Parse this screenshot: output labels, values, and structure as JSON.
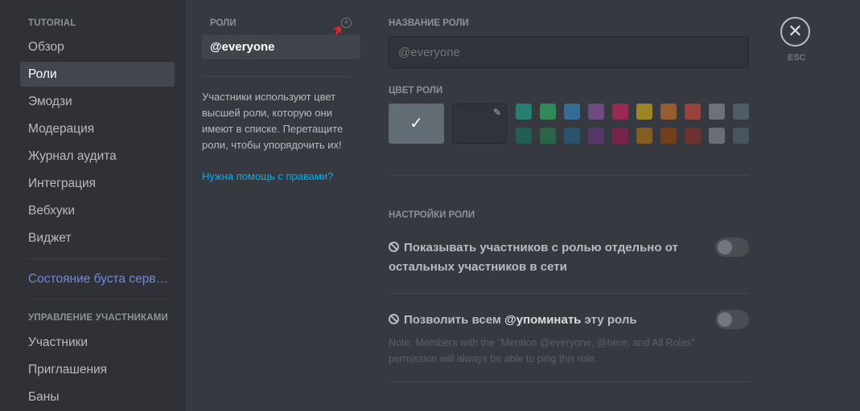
{
  "sidebar": {
    "section_tutorial": "TUTORIAL",
    "items": [
      {
        "label": "Обзор"
      },
      {
        "label": "Роли"
      },
      {
        "label": "Эмодзи"
      },
      {
        "label": "Модерация"
      },
      {
        "label": "Журнал аудита"
      },
      {
        "label": "Интеграция"
      },
      {
        "label": "Вебхуки"
      },
      {
        "label": "Виджет"
      }
    ],
    "boost_status": "Состояние буста серв…",
    "section_members": "УПРАВЛЕНИЕ УЧАСТНИКАМИ",
    "member_items": [
      {
        "label": "Участники"
      },
      {
        "label": "Приглашения"
      },
      {
        "label": "Баны"
      }
    ]
  },
  "roles": {
    "header": "РОЛИ",
    "add_icon": "plus-circle-icon",
    "items": [
      {
        "name": "@everyone"
      }
    ],
    "hint": "Участники используют цвет высшей роли, которую они имеют в списке. Перетащите роли, чтобы упорядочить их!",
    "help_link": "Нужна помощь с правами?"
  },
  "role_settings": {
    "name_label": "НАЗВАНИЕ РОЛИ",
    "name_placeholder": "@everyone",
    "color_label": "ЦВЕТ РОЛИ",
    "default_color": "#99aab5",
    "swatches_row1": [
      "#1abc9c",
      "#2ecc71",
      "#3498db",
      "#9b59b6",
      "#e91e63",
      "#f1c40f",
      "#e67e22",
      "#e74c3c",
      "#95a5a6",
      "#607d8b"
    ],
    "swatches_row2": [
      "#11806a",
      "#1f8b4c",
      "#206694",
      "#71368a",
      "#ad1457",
      "#c27c0e",
      "#a84300",
      "#992d22",
      "#979c9f",
      "#546e7a"
    ],
    "settings_header": "НАСТРОЙКИ РОЛИ",
    "hoist_text": "Показывать участников с ролью отдельно от остальных участников в сети",
    "hoist_enabled": false,
    "mention_prefix": "Позволить всем ",
    "mention_bold": "@упоминать",
    "mention_suffix": " эту роль",
    "mention_enabled": false,
    "mention_note": "Note: Members with the \"Mention @everyone, @here, and All Roles\" permission will always be able to ping this role."
  },
  "close": {
    "icon": "close-icon",
    "label": "ESC"
  }
}
